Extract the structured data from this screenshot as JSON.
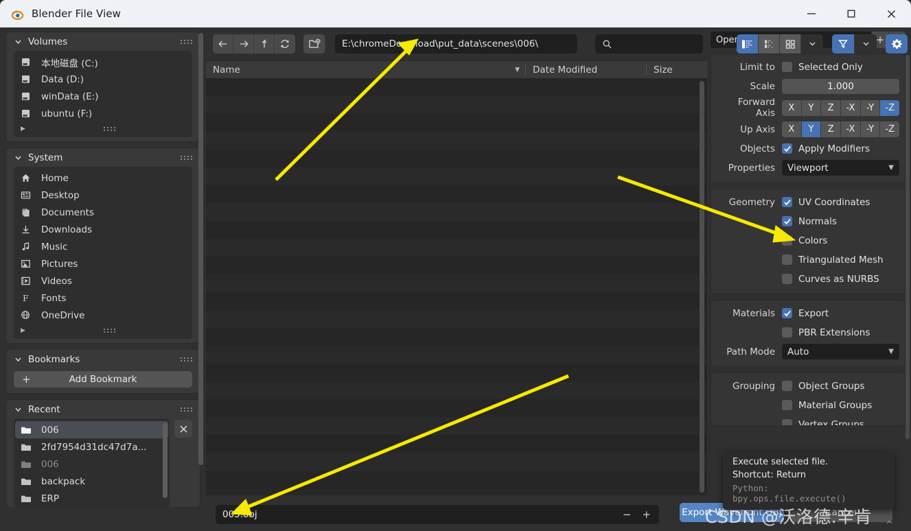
{
  "window": {
    "title": "Blender File View",
    "app_icon": "blender-logo-icon",
    "minimize": "—",
    "maximize": "□",
    "close": "✕"
  },
  "sidebar": {
    "panels": [
      {
        "title": "Volumes",
        "items": [
          {
            "label": "本地磁盘 (C:)",
            "icon": "disk-icon",
            "selected": false,
            "dim": false
          },
          {
            "label": "Data (D:)",
            "icon": "disk-icon",
            "selected": false,
            "dim": false
          },
          {
            "label": "winData (E:)",
            "icon": "disk-icon",
            "selected": false,
            "dim": false
          },
          {
            "label": "ubuntu (F:)",
            "icon": "disk-icon",
            "selected": false,
            "dim": false
          }
        ],
        "has_more": true
      },
      {
        "title": "System",
        "items": [
          {
            "label": "Home",
            "icon": "home-icon",
            "selected": false,
            "dim": false
          },
          {
            "label": "Desktop",
            "icon": "desktop-icon",
            "selected": false,
            "dim": false
          },
          {
            "label": "Documents",
            "icon": "documents-icon",
            "selected": false,
            "dim": false
          },
          {
            "label": "Downloads",
            "icon": "download-icon",
            "selected": false,
            "dim": false
          },
          {
            "label": "Music",
            "icon": "music-note-icon",
            "selected": false,
            "dim": false
          },
          {
            "label": "Pictures",
            "icon": "picture-icon",
            "selected": false,
            "dim": false
          },
          {
            "label": "Videos",
            "icon": "film-icon",
            "selected": false,
            "dim": false
          },
          {
            "label": "Fonts",
            "icon": "font-f-icon",
            "selected": false,
            "dim": false
          },
          {
            "label": "OneDrive",
            "icon": "globe-icon",
            "selected": false,
            "dim": false
          }
        ],
        "has_more": true
      }
    ],
    "bookmarks": {
      "title": "Bookmarks",
      "add_label": "Add Bookmark",
      "add_icon": "plus-icon"
    },
    "recent": {
      "title": "Recent",
      "clear_icon": "close-x-icon",
      "items": [
        {
          "label": "006",
          "icon": "folder-icon",
          "selected": true,
          "dim": false
        },
        {
          "label": "2fd7954d31dc47d7a...",
          "icon": "folder-icon",
          "selected": false,
          "dim": false
        },
        {
          "label": "006",
          "icon": "folder-icon",
          "selected": false,
          "dim": true
        },
        {
          "label": "backpack",
          "icon": "folder-icon",
          "selected": false,
          "dim": false
        },
        {
          "label": "ERP",
          "icon": "folder-icon",
          "selected": false,
          "dim": false
        }
      ]
    }
  },
  "toolbar": {
    "back_icon": "arrow-left-icon",
    "forward_icon": "arrow-right-icon",
    "up_icon": "arrow-up-icon",
    "refresh_icon": "refresh-icon",
    "new_folder_icon": "new-folder-icon",
    "path": "E:\\chromeDownload\\put_data\\scenes\\006\\",
    "search_placeholder": "",
    "search_value": "",
    "search_icon": "search-icon",
    "view_vertical_list_icon": "vertical-list-icon",
    "view_horizontal_list_icon": "horizontal-list-icon",
    "view_thumbnail_icon": "thumbnail-grid-icon",
    "display_dropdown_icon": "chevron-down-icon",
    "filter_icon": "filter-funnel-icon",
    "filter_dropdown_icon": "chevron-down-icon",
    "settings_icon": "gear-icon"
  },
  "filelist": {
    "columns": [
      "Name",
      "Date Modified",
      "Size"
    ],
    "sort_icon": "sort-descending-icon",
    "rows": [],
    "row_count": 23
  },
  "filename_field": {
    "value": "005.obj",
    "decrement": "−",
    "increment": "+"
  },
  "operator_panel": {
    "presets": {
      "label": "Operator Presets",
      "dropdown_icon": "chevron-down-icon",
      "add": "+",
      "remove": "−"
    },
    "groups": [
      {
        "rows": [
          {
            "type": "checkbox",
            "label": "Limit to",
            "option": "Selected Only",
            "checked": false
          },
          {
            "type": "number",
            "label": "Scale",
            "value": "1.000"
          },
          {
            "type": "axis",
            "label": "Forward Axis",
            "options": [
              "X",
              "Y",
              "Z",
              "-X",
              "-Y",
              "-Z"
            ],
            "selected": "-Z"
          },
          {
            "type": "axis",
            "label": "Up Axis",
            "options": [
              "X",
              "Y",
              "Z",
              "-X",
              "-Y",
              "-Z"
            ],
            "selected": "Y"
          },
          {
            "type": "checkbox",
            "label": "Objects",
            "option": "Apply Modifiers",
            "checked": true
          },
          {
            "type": "dropdown",
            "label": "Properties",
            "value": "Viewport"
          }
        ]
      },
      {
        "rows": [
          {
            "type": "checkbox",
            "label": "Geometry",
            "option": "UV Coordinates",
            "checked": true
          },
          {
            "type": "checkbox",
            "label": "",
            "option": "Normals",
            "checked": true
          },
          {
            "type": "checkbox",
            "label": "",
            "option": "Colors",
            "checked": false
          },
          {
            "type": "checkbox",
            "label": "",
            "option": "Triangulated Mesh",
            "checked": false
          },
          {
            "type": "checkbox",
            "label": "",
            "option": "Curves as NURBS",
            "checked": false
          }
        ]
      },
      {
        "rows": [
          {
            "type": "checkbox",
            "label": "Materials",
            "option": "Export",
            "checked": true
          },
          {
            "type": "checkbox",
            "label": "",
            "option": "PBR Extensions",
            "checked": false
          },
          {
            "type": "dropdown",
            "label": "Path Mode",
            "value": "Auto"
          }
        ]
      },
      {
        "rows": [
          {
            "type": "checkbox",
            "label": "Grouping",
            "option": "Object Groups",
            "checked": false
          },
          {
            "type": "checkbox",
            "label": "",
            "option": "Material Groups",
            "checked": false
          },
          {
            "type": "checkbox",
            "label": "",
            "option": "Vertex Groups",
            "checked": false
          }
        ]
      }
    ]
  },
  "tooltip": {
    "line1": "Execute selected file.",
    "line2": "Shortcut: Return",
    "line3": "Python: bpy.ops.file.execute()"
  },
  "actions": {
    "export_label": "Export Wavefront OBJ",
    "cancel_label": "Cancel",
    "caret_icon": "chevron-up-icon"
  },
  "watermark": "CSDN @沃洛德.辛肯",
  "colors": {
    "accent_blue": "#4772b3",
    "button_blue": "#5585c4",
    "panel_bg": "#353535",
    "sidebar_bg": "#303030",
    "field_bg": "#1f1f1f",
    "arrow_yellow": "#f5ea00",
    "titlebar_bg": "#eef1f5"
  }
}
